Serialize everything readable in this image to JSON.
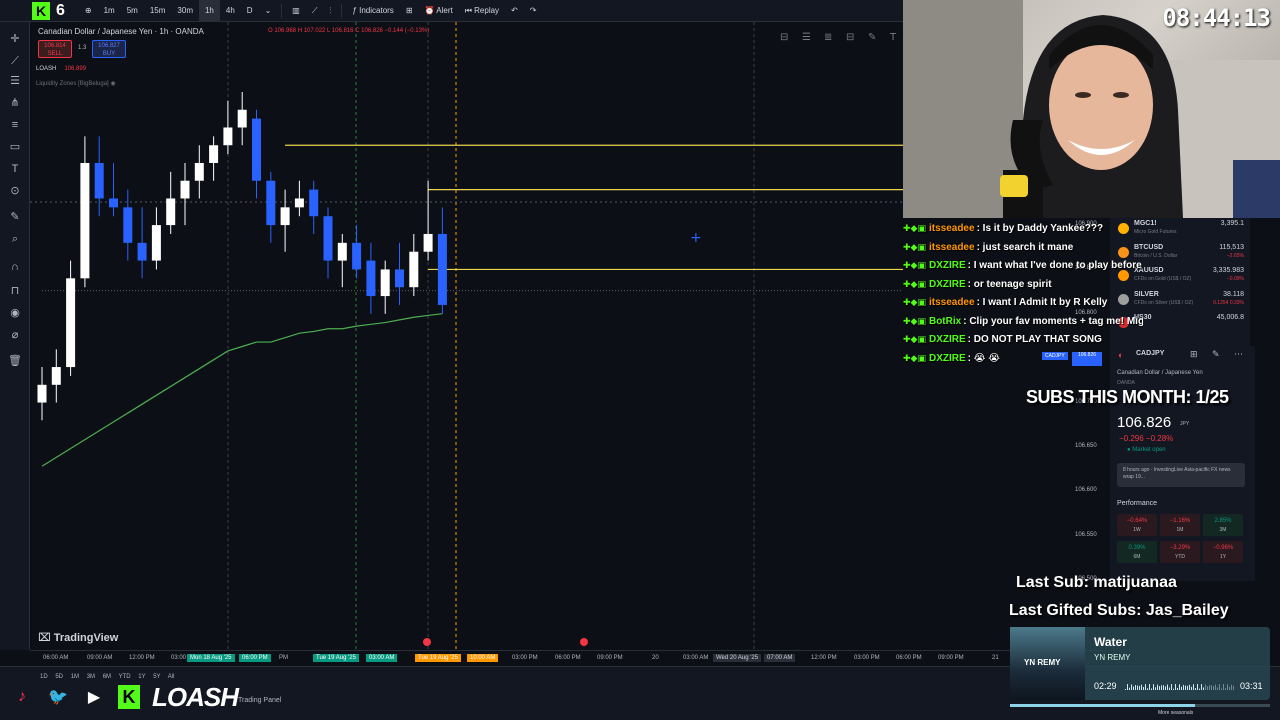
{
  "toolbar": {
    "kick_badge": "K",
    "kick_count": "6",
    "intervals": [
      "1m",
      "5m",
      "15m",
      "30m",
      "1h",
      "4h",
      "D"
    ],
    "active_interval": "1h",
    "indicators": "Indicators",
    "alert": "Alert",
    "replay": "Replay"
  },
  "chart_header": {
    "symbol": "Canadian Dollar / Japanese Yen · 1h · OANDA",
    "ohlc": "O 106.968 H 107.022 L 106.816 C 106.826 −0.144 (−0.13%)",
    "sell_price": "106.814",
    "sell_label": "SELL",
    "spread": "1.3",
    "buy_price": "106.827",
    "buy_label": "BUY",
    "indicator1_name": "LOASH",
    "indicator1_value": "106.899",
    "indicator2_name": "Liquidity Zones [BigBeluga]"
  },
  "price_axis": [
    {
      "label": "107.000",
      "value": 107.0
    },
    {
      "label": "106.950",
      "value": 106.95
    },
    {
      "label": "106.900",
      "value": 106.9
    },
    {
      "label": "106.850",
      "value": 106.85
    },
    {
      "label": "106.800",
      "value": 106.8
    },
    {
      "label": "106.750",
      "value": 106.75
    },
    {
      "label": "106.700",
      "value": 106.7
    },
    {
      "label": "106.650",
      "value": 106.65
    },
    {
      "label": "106.600",
      "value": 106.6
    },
    {
      "label": "106.550",
      "value": 106.55
    },
    {
      "label": "106.500",
      "value": 106.5
    }
  ],
  "price_tag": {
    "symbol": "CADJPY",
    "value": "106.826"
  },
  "time_axis": [
    {
      "label": "06:00 AM",
      "style": ""
    },
    {
      "label": "09:00 AM",
      "style": ""
    },
    {
      "label": "12:00 PM",
      "style": ""
    },
    {
      "label": "03:00",
      "style": ""
    },
    {
      "label": "Mon 18 Aug '25",
      "style": "hl-green"
    },
    {
      "label": "06:00 PM",
      "style": "hl-green"
    },
    {
      "label": "PM",
      "style": ""
    },
    {
      "label": "Tue 19 Aug '25",
      "style": "hl-green"
    },
    {
      "label": "03:00 AM",
      "style": "hl-green"
    },
    {
      "label": "Tue 19 Aug '25",
      "style": "hl-orange"
    },
    {
      "label": "10:00 AM",
      "style": "hl-orange"
    },
    {
      "label": "03:00 PM",
      "style": ""
    },
    {
      "label": "06:00 PM",
      "style": ""
    },
    {
      "label": "09:00 PM",
      "style": ""
    },
    {
      "label": "20",
      "style": ""
    },
    {
      "label": "03:00 AM",
      "style": ""
    },
    {
      "label": "Wed 20 Aug '25",
      "style": "hl-gray"
    },
    {
      "label": "07:00 AM",
      "style": "hl-gray"
    },
    {
      "label": "12:00 PM",
      "style": ""
    },
    {
      "label": "03:00 PM",
      "style": ""
    },
    {
      "label": "06:00 PM",
      "style": ""
    },
    {
      "label": "09:00 PM",
      "style": ""
    },
    {
      "label": "21",
      "style": ""
    }
  ],
  "tradingview_logo": "TradingView",
  "bottom": {
    "ranges": [
      "1D",
      "5D",
      "1M",
      "3M",
      "6M",
      "YTD",
      "1Y",
      "5Y",
      "All"
    ],
    "trading_panel": "Trading Panel",
    "brand": "LOASH",
    "brand_k": "K"
  },
  "webcam": {
    "clock": "08:44:13"
  },
  "chat": [
    {
      "user": "itsseadee",
      "color": "#ff9800",
      "text": "Is it by Daddy Yankee???"
    },
    {
      "user": "itsseadee",
      "color": "#ff9800",
      "text": "just search it mane"
    },
    {
      "user": "DXZIRE",
      "color": "#53fc18",
      "text": "I want what I've done to play before my set"
    },
    {
      "user": "DXZIRE",
      "color": "#53fc18",
      "text": "or teenage spirit"
    },
    {
      "user": "itsseadee",
      "color": "#ff9800",
      "text": "I want I Admit It by R Kelly"
    },
    {
      "user": "BotRix",
      "color": "#53fc18",
      "text": "Clip your fav moments + tag me! Might feature you 👀 🔥"
    },
    {
      "user": "DXZIRE",
      "color": "#53fc18",
      "text": "DO NOT PLAY THAT SONG"
    },
    {
      "user": "DXZIRE",
      "color": "#53fc18",
      "text": "😭 😭"
    }
  ],
  "watchlist": [
    {
      "symbol": "MGC1!",
      "desc": "Micro Gold Futures",
      "price": "3,395.1",
      "change": "",
      "icon_color": "#ffb300"
    },
    {
      "symbol": "BTCUSD",
      "desc": "Bitcoin / U.S. Dollar",
      "price": "115,513",
      "change": "−2.65%",
      "icon_color": "#f7931a"
    },
    {
      "symbol": "XAUUSD",
      "desc": "CFDs on Gold (US$ / OZ)",
      "price": "3,335.983",
      "change": "−0.09%",
      "icon_color": "#ff9800"
    },
    {
      "symbol": "SILVER",
      "desc": "CFDs on Silver (US$ / OZ)",
      "price": "38.118",
      "change": "0.1254  0.33%",
      "icon_color": "#9e9e9e"
    },
    {
      "symbol": "US30",
      "desc": "",
      "price": "45,006.8",
      "change": "",
      "icon_color": "#d32f2f"
    }
  ],
  "details": {
    "symbol": "CADJPY",
    "name": "Canadian Dollar / Japanese Yen",
    "exchange": "OANDA",
    "price": "106.826",
    "unit": "JPY",
    "change": "−0.296  −0.28%",
    "status": "Market open",
    "news": "8 hours ago · InvestingLive  Asia-pacific FX news wrap 19...",
    "performance_label": "Performance",
    "performance": [
      {
        "value": "−0.64%",
        "period": "1W",
        "sign": "neg"
      },
      {
        "value": "−1.16%",
        "period": "1M",
        "sign": "neg"
      },
      {
        "value": "2.85%",
        "period": "3M",
        "sign": "pos"
      },
      {
        "value": "0.39%",
        "period": "6M",
        "sign": "pos"
      },
      {
        "value": "−3.29%",
        "period": "YTD",
        "sign": "neg"
      },
      {
        "value": "−0.96%",
        "period": "1Y",
        "sign": "neg"
      }
    ]
  },
  "overlay": {
    "subs_month": "SUBS THIS MONTH: 1/25",
    "last_sub": "Last Sub: matijuanaa",
    "last_gifted": "Last Gifted Subs: Jas_Bailey"
  },
  "music": {
    "album_text": "YN REMY",
    "track": "Water",
    "artist": "YN REMY",
    "elapsed": "02:29",
    "duration": "03:31",
    "progress": 0.71
  },
  "more_seasonals": "More seasonals",
  "colors": {
    "bull": "#ffffff",
    "bear": "#2962ff",
    "ema": "#4caf50",
    "zone": "#e8d44d",
    "accent": "#2962ff",
    "kick": "#53fc18"
  },
  "chart_data": {
    "type": "candlestick",
    "ylim": [
      106.5,
      107.05
    ],
    "candles": [
      {
        "o": 106.7,
        "h": 106.74,
        "l": 106.68,
        "c": 106.72
      },
      {
        "o": 106.72,
        "h": 106.76,
        "l": 106.7,
        "c": 106.74
      },
      {
        "o": 106.74,
        "h": 106.86,
        "l": 106.73,
        "c": 106.84
      },
      {
        "o": 106.84,
        "h": 107.0,
        "l": 106.83,
        "c": 106.97
      },
      {
        "o": 106.97,
        "h": 107.0,
        "l": 106.91,
        "c": 106.93
      },
      {
        "o": 106.93,
        "h": 106.97,
        "l": 106.91,
        "c": 106.92
      },
      {
        "o": 106.92,
        "h": 106.94,
        "l": 106.86,
        "c": 106.88
      },
      {
        "o": 106.88,
        "h": 106.92,
        "l": 106.84,
        "c": 106.86
      },
      {
        "o": 106.86,
        "h": 106.92,
        "l": 106.85,
        "c": 106.9
      },
      {
        "o": 106.9,
        "h": 106.96,
        "l": 106.89,
        "c": 106.93
      },
      {
        "o": 106.93,
        "h": 106.97,
        "l": 106.9,
        "c": 106.95
      },
      {
        "o": 106.95,
        "h": 106.99,
        "l": 106.93,
        "c": 106.97
      },
      {
        "o": 106.97,
        "h": 107.0,
        "l": 106.95,
        "c": 106.99
      },
      {
        "o": 106.99,
        "h": 107.04,
        "l": 106.98,
        "c": 107.01
      },
      {
        "o": 107.01,
        "h": 107.05,
        "l": 106.99,
        "c": 107.03
      },
      {
        "o": 107.02,
        "h": 107.03,
        "l": 106.93,
        "c": 106.95
      },
      {
        "o": 106.95,
        "h": 106.96,
        "l": 106.88,
        "c": 106.9
      },
      {
        "o": 106.9,
        "h": 106.94,
        "l": 106.87,
        "c": 106.92
      },
      {
        "o": 106.92,
        "h": 106.95,
        "l": 106.91,
        "c": 106.93
      },
      {
        "o": 106.94,
        "h": 106.95,
        "l": 106.89,
        "c": 106.91
      },
      {
        "o": 106.91,
        "h": 106.92,
        "l": 106.84,
        "c": 106.86
      },
      {
        "o": 106.86,
        "h": 106.89,
        "l": 106.83,
        "c": 106.88
      },
      {
        "o": 106.88,
        "h": 106.9,
        "l": 106.84,
        "c": 106.85
      },
      {
        "o": 106.86,
        "h": 106.88,
        "l": 106.8,
        "c": 106.82
      },
      {
        "o": 106.82,
        "h": 106.86,
        "l": 106.8,
        "c": 106.85
      },
      {
        "o": 106.85,
        "h": 106.88,
        "l": 106.81,
        "c": 106.83
      },
      {
        "o": 106.83,
        "h": 106.89,
        "l": 106.82,
        "c": 106.87
      },
      {
        "o": 106.87,
        "h": 106.95,
        "l": 106.86,
        "c": 106.89
      },
      {
        "o": 106.89,
        "h": 106.92,
        "l": 106.8,
        "c": 106.81
      }
    ],
    "ema": [
      106.68,
      106.69,
      106.7,
      106.71,
      106.72,
      106.73,
      106.74,
      106.75,
      106.76,
      106.77,
      106.78,
      106.79,
      106.8,
      106.81,
      106.815,
      106.82,
      106.82,
      106.825,
      106.83,
      106.832,
      106.835,
      106.835,
      106.838,
      106.84,
      106.842,
      106.845,
      106.848,
      106.85,
      106.852
    ],
    "zones": [
      {
        "y": 106.99,
        "x_from": 17
      },
      {
        "y": 106.94,
        "x_from": 27
      },
      {
        "y": 106.85,
        "x_from": 27
      },
      {
        "y": 106.826,
        "x_from": 0
      }
    ]
  }
}
